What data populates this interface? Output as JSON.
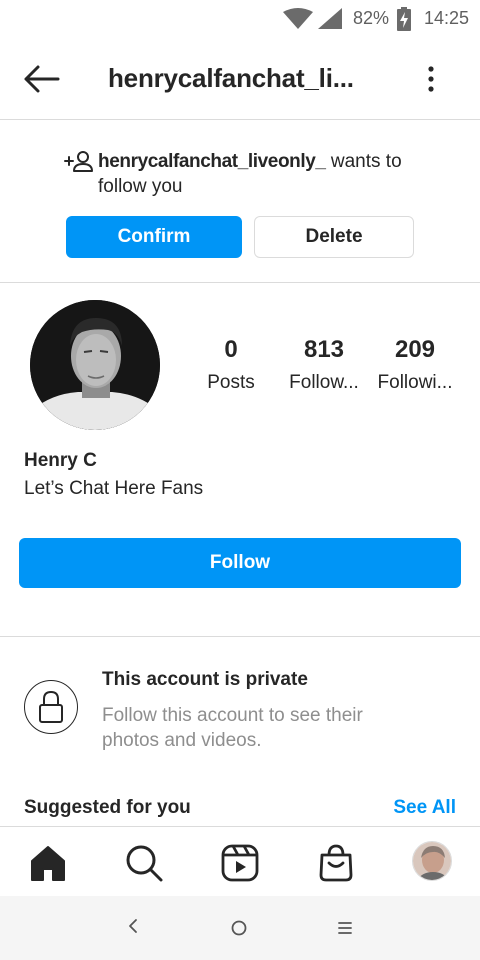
{
  "status_bar": {
    "battery_percent": "82%",
    "time": "14:25",
    "icons": [
      "wifi-icon",
      "signal-icon",
      "battery-charging-icon"
    ]
  },
  "header": {
    "title": "henrycalfanchat_li...",
    "back_icon": "back-arrow-icon",
    "menu_icon": "more-vertical-icon"
  },
  "follow_request": {
    "icon": "add-person-icon",
    "username": "henrycalfanchat_liveonly_",
    "message": " wants to follow you",
    "confirm_label": "Confirm",
    "delete_label": "Delete"
  },
  "profile": {
    "posts_count": "0",
    "posts_label": "Posts",
    "followers_count": "813",
    "followers_label": "Follow...",
    "following_count": "209",
    "following_label": "Followi...",
    "name": "Henry C",
    "bio": "Let’s Chat Here Fans",
    "follow_label": "Follow"
  },
  "private_notice": {
    "icon": "lock-icon",
    "title": "This account is private",
    "subtitle": "Follow this account to see their photos and videos."
  },
  "suggested": {
    "title": "Suggested for you",
    "see_all_label": "See All"
  },
  "bottom_nav": {
    "items": [
      "home-icon",
      "search-icon",
      "reels-icon",
      "shop-icon",
      "profile-avatar"
    ]
  },
  "system_nav": {
    "items": [
      "back",
      "home",
      "recents"
    ]
  },
  "colors": {
    "accent": "#0095f6",
    "text": "#262626",
    "secondary_text": "#8e8e8e",
    "divider": "#dbdbdb"
  }
}
